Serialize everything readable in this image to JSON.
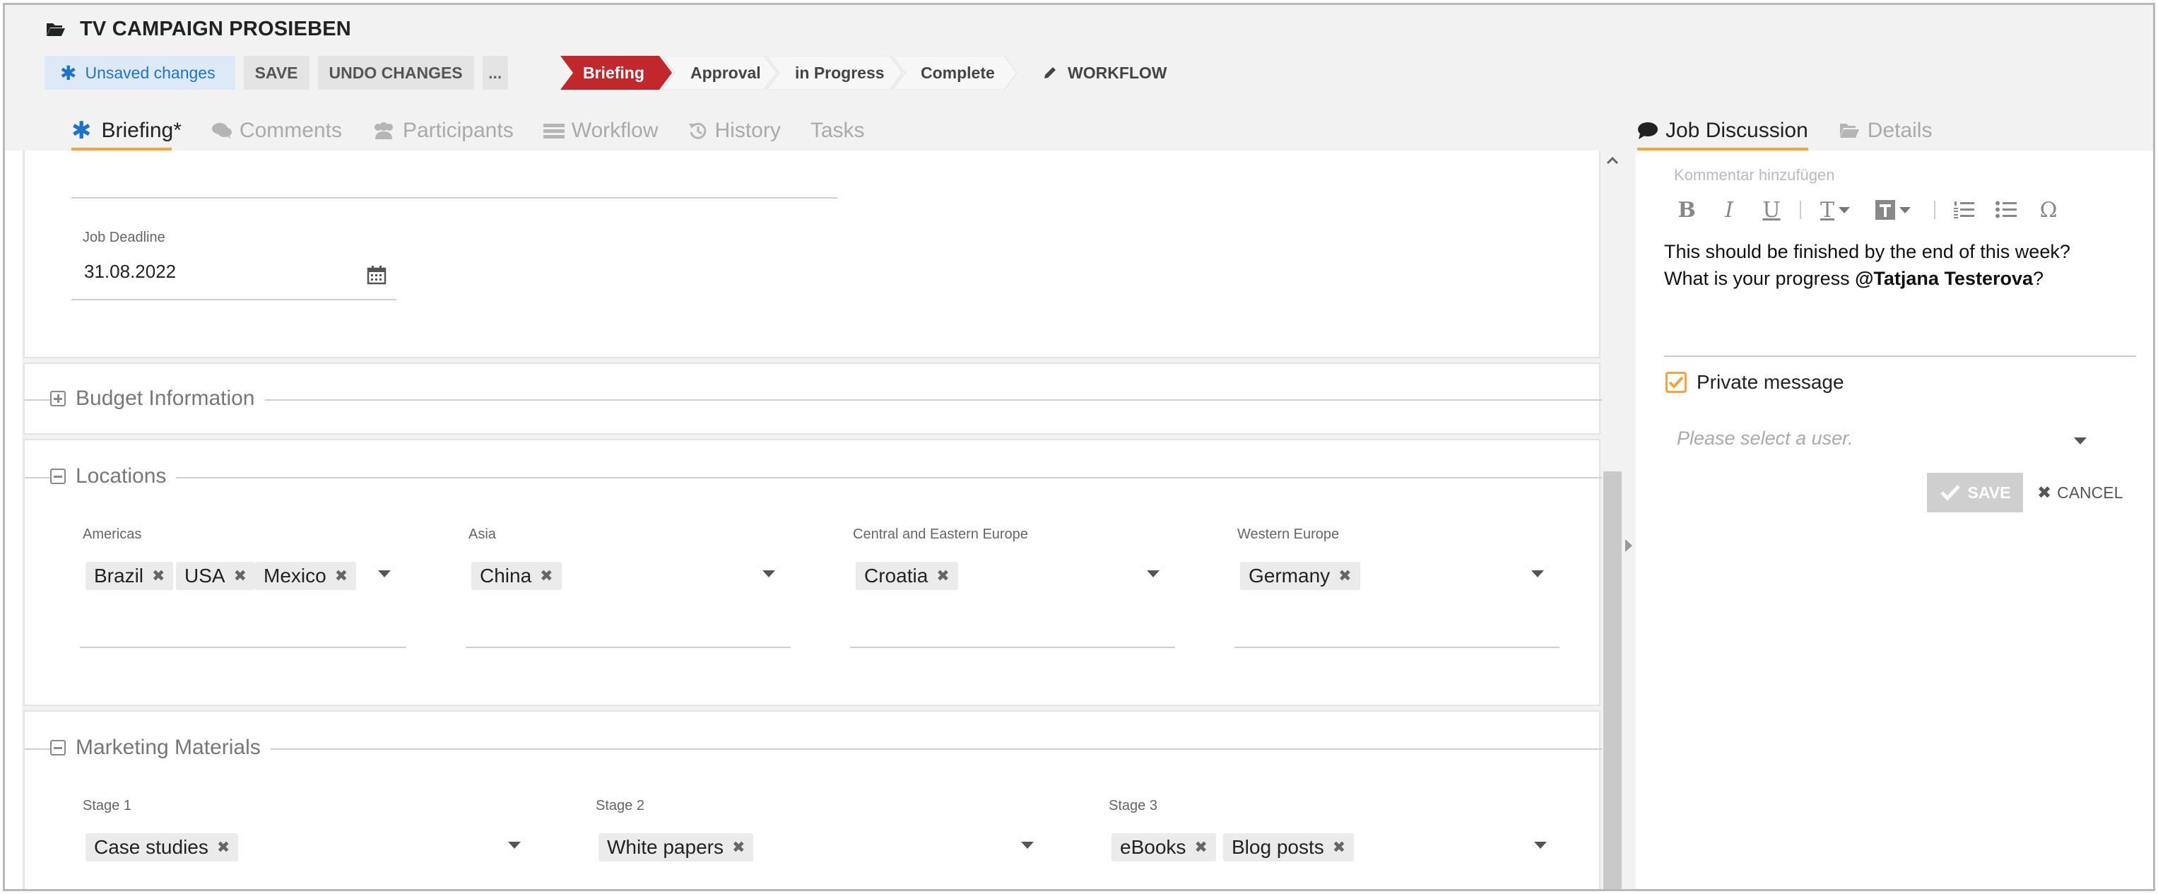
{
  "header": {
    "title": "TV CAMPAIGN PROSIEBEN",
    "toolbar": {
      "unsaved_label": "Unsaved changes",
      "save_label": "SAVE",
      "undo_label": "UNDO CHANGES",
      "more_label": "..."
    },
    "stages": [
      {
        "label": "Briefing",
        "active": true
      },
      {
        "label": "Approval",
        "active": false
      },
      {
        "label": "in Progress",
        "active": false
      },
      {
        "label": "Complete",
        "active": false
      }
    ],
    "workflow_label": "WORKFLOW",
    "accent_color": "#c0282e"
  },
  "tabs": [
    {
      "label": "Briefing*",
      "active": true
    },
    {
      "label": "Comments",
      "active": false
    },
    {
      "label": "Participants",
      "active": false
    },
    {
      "label": "Workflow",
      "active": false
    },
    {
      "label": "History",
      "active": false
    },
    {
      "label": "Tasks",
      "active": false
    }
  ],
  "right_tabs": [
    {
      "label": "Job Discussion",
      "active": true
    },
    {
      "label": "Details",
      "active": false
    }
  ],
  "form": {
    "job_deadline": {
      "label": "Job Deadline",
      "value": "31.08.2022"
    },
    "budget": {
      "legend": "Budget Information"
    },
    "locations": {
      "legend": "Locations",
      "groups": [
        {
          "label": "Americas",
          "tags": [
            "Brazil",
            "USA",
            "Mexico"
          ]
        },
        {
          "label": "Asia",
          "tags": [
            "China"
          ]
        },
        {
          "label": "Central and Eastern Europe",
          "tags": [
            "Croatia"
          ]
        },
        {
          "label": "Western Europe",
          "tags": [
            "Germany"
          ]
        }
      ]
    },
    "marketing": {
      "legend": "Marketing Materials",
      "groups": [
        {
          "label": "Stage 1",
          "tags": [
            "Case studies"
          ]
        },
        {
          "label": "Stage 2",
          "tags": [
            "White papers"
          ]
        },
        {
          "label": "Stage 3",
          "tags": [
            "eBooks",
            "Blog posts"
          ]
        }
      ]
    }
  },
  "discussion": {
    "placeholder": "Kommentar hinzufügen",
    "message_line1": "This should be finished by the end of this week?",
    "message_line2_prefix": "What is your progress ",
    "mention": "@Tatjana Testerova",
    "message_line2_suffix": "?",
    "private_label": "Private message",
    "private_checked": true,
    "select_user_placeholder": "Please select a user.",
    "save_label": "SAVE",
    "cancel_label": "CANCEL"
  }
}
